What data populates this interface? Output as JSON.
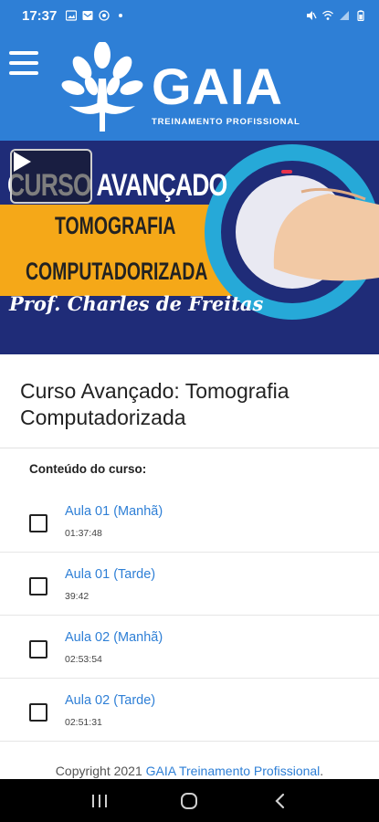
{
  "status_bar": {
    "time": "17:37",
    "icons": [
      "image-icon",
      "message-icon",
      "whatsapp-icon",
      "dot-icon",
      "mute-icon",
      "wifi-icon",
      "signal-icon",
      "battery-icon"
    ]
  },
  "header": {
    "menu_icon": "menu-icon",
    "brand_name": "GAIA",
    "brand_subtitle": "TREINAMENTO PROFISSIONAL"
  },
  "banner": {
    "line1": "CURSO AVANÇADO",
    "line2": "TOMOGRAFIA",
    "line3": "COMPUTADORIZADA",
    "line4": "Prof. Charles de Freitas",
    "play_icon": "play-icon"
  },
  "course": {
    "title": "Curso Avançado: Tomografia Computadorizada",
    "content_label": "Conteúdo do curso:",
    "lessons": [
      {
        "title": "Aula 01 (Manhã)",
        "duration": "01:37:48"
      },
      {
        "title": "Aula 01 (Tarde)",
        "duration": "39:42"
      },
      {
        "title": "Aula 02 (Manhã)",
        "duration": "02:53:54"
      },
      {
        "title": "Aula 02 (Tarde)",
        "duration": "02:51:31"
      }
    ]
  },
  "footer": {
    "prefix": "Copyright 2021 ",
    "link": "GAIA Treinamento Profissional",
    "suffix": "."
  },
  "nav_bar": {
    "icons": [
      "recent-apps-icon",
      "home-icon",
      "back-icon"
    ]
  },
  "colors": {
    "primary": "#2e7fd6",
    "banner_bg": "#1e2d7a",
    "banner_stripe": "#f5a818",
    "link": "#2e7fd6"
  }
}
